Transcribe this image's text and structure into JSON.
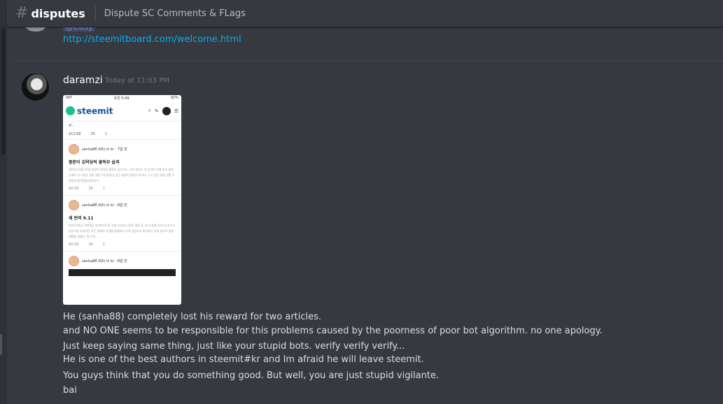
{
  "header": {
    "hash_icon": "#",
    "channel_name": "disputes",
    "topic": "Dispute SC Comments & FLags"
  },
  "previous_message": {
    "mention": "@easy",
    "link": "http://steemitboard.com/welcome.html"
  },
  "message": {
    "username": "daramzi",
    "timestamp": "Today at 11:03 PM",
    "attachment": {
      "carrier": "SKT",
      "time": "오전 5:49",
      "battery": "92%",
      "logo": "steemit",
      "top_row": "로...",
      "stats": [
        "$13.68",
        "25",
        "1"
      ],
      "posts": [
        {
          "author": "sanha88 (65) in kr · 7일 전",
          "title": "봉분이 김약상의 흥독부 습격",
          "body": "1921년 6월 12일 봉분이 김약상 흥독부 습격 어느 나라 역사도 의 천가지 전에 한국 현대사에도 이 사람은 정말 영웅 우인공이다 김은 사람이 한동이 아니다 그 다 김은 일본 경찰 1천명과 총격전을 벌이다가",
          "foot": [
            "$0.00",
            "26",
            "7"
          ]
        },
        {
          "author": "sanha88 (65) in kr · 8일 전",
          "title": "세 번의 9.11",
          "body": "9년의 9일간 2001년 세 번의 9.11 사태 가운데 시작된 평야 후, 8 이 함께 아우구스투스는 이라크에 유리하던 모든 세계의 국경을 통제하고 수백 있었다고 밝히었다 일에 있으로 출동 계획을 세웠다. 일 우하...",
          "foot": [
            "$0.00",
            "36",
            "2"
          ]
        },
        {
          "author": "sanha88 (65) in kr · 8일 전",
          "title": "",
          "body": "",
          "foot": []
        }
      ]
    },
    "lines": [
      "He (sanha88) completely lost his reward for two articles.",
      "and NO ONE seems to be responsible for this problems caused by the poorness of poor bot algorithm. no one apology.",
      "Just keep saying same thing, just like your stupid bots. verify verify verify...",
      "He is one of the best authors in steemit#kr and Im afraid he will leave steemit.",
      "You guys think that you do something good. But well, you are just stupid vigilante.",
      "bai"
    ]
  }
}
